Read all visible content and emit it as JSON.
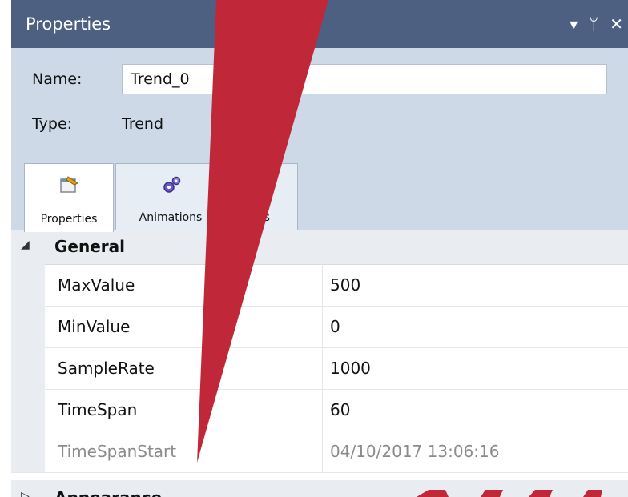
{
  "panel": {
    "title": "Properties",
    "title_icons": [
      "chevron-down-icon",
      "pin-icon",
      "close-icon"
    ],
    "title_glyphs": {
      "dropdown": "▾",
      "pin": "ᛘ",
      "close": "✕"
    },
    "name_label": "Name:",
    "name_value": "Trend_0",
    "type_label": "Type:",
    "type_value": "Trend"
  },
  "tabs": [
    {
      "label": "Properties",
      "icon": "properties-icon",
      "active": true
    },
    {
      "label": "Animations",
      "icon": "gears-icon",
      "active": false
    }
  ],
  "tab_partial_text": "es",
  "categories": [
    {
      "name": "General",
      "toggle": "◢",
      "expanded": true
    },
    {
      "name": "Appearance",
      "toggle": "▷",
      "expanded": false
    }
  ],
  "properties": [
    {
      "name": "MaxValue",
      "value": "500",
      "readonly": false
    },
    {
      "name": "MinValue",
      "value": "0",
      "readonly": false
    },
    {
      "name": "SampleRate",
      "value": "1000",
      "readonly": false
    },
    {
      "name": "TimeSpan",
      "value": "60",
      "readonly": false
    },
    {
      "name": "TimeSpanStart",
      "value": "04/10/2017 13:06:16",
      "readonly": true
    }
  ],
  "colors": {
    "title_bar": "#4d6082",
    "header_bg": "#ced9e7",
    "category_bg": "#e9edf2",
    "annotation_pointer": "#c0283a"
  }
}
